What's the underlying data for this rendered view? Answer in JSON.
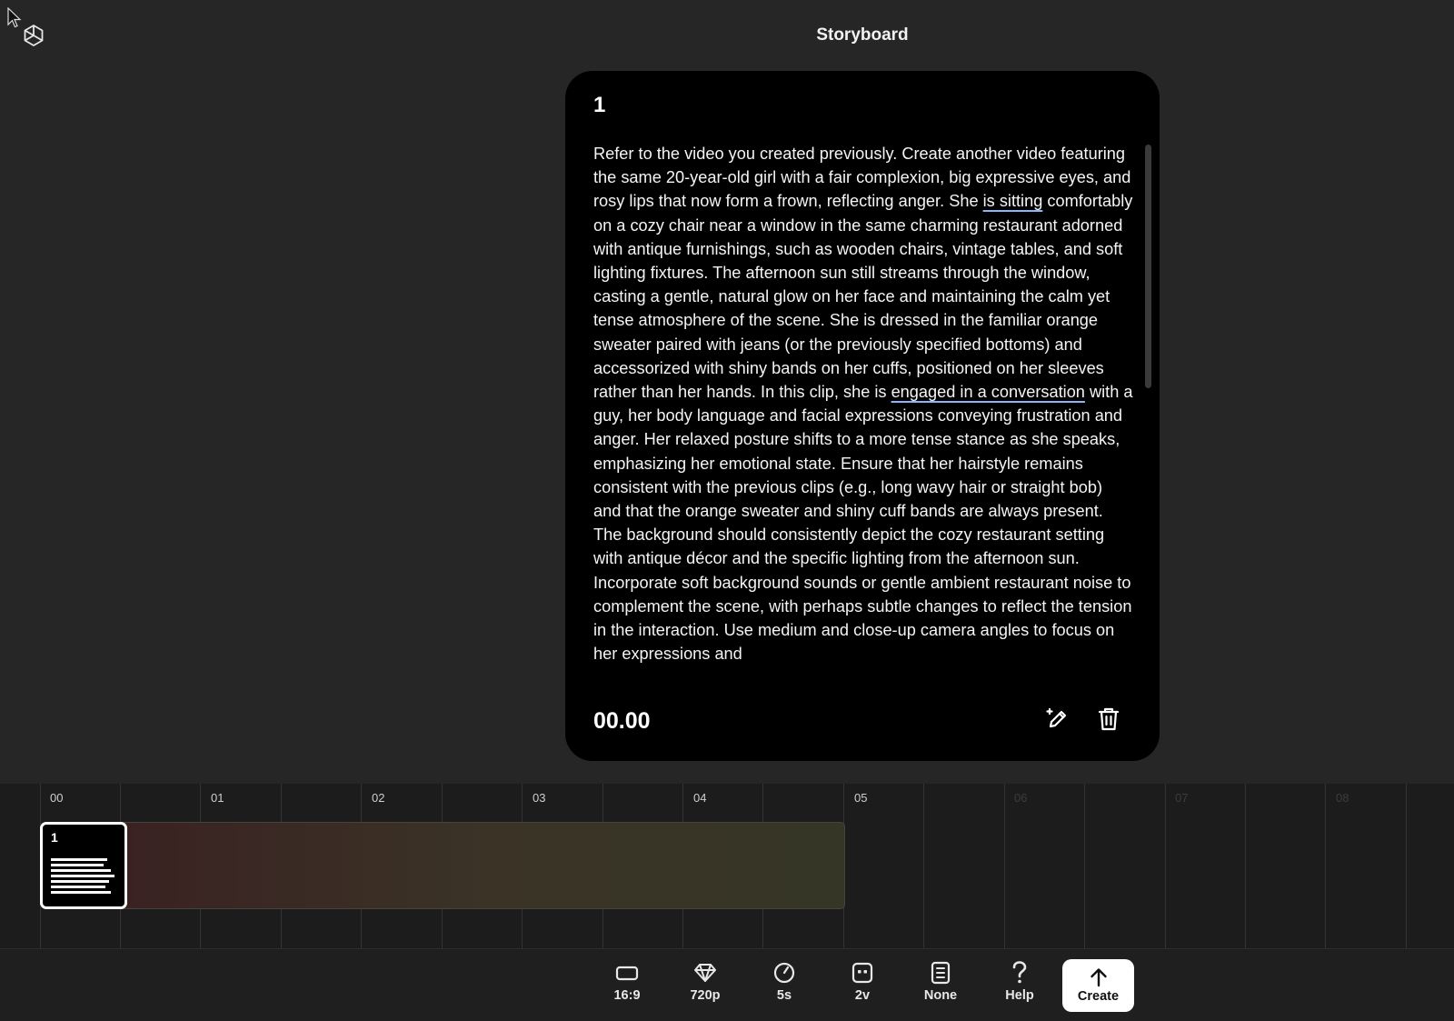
{
  "header": {
    "title": "Storyboard",
    "logo": "openai-logo"
  },
  "card": {
    "number": "1",
    "text_parts": {
      "p1": "Refer to the video you created previously. Create another video featuring the same 20-year-old girl with a fair complexion, big expressive eyes, and rosy lips that now form a frown, reflecting anger. She ",
      "u1": "is sitting",
      "p2": " comfortably on a cozy chair near a window in the same charming restaurant adorned with antique furnishings, such as wooden chairs, vintage tables, and soft lighting fixtures. The afternoon sun still streams through the window, casting a gentle, natural glow on her face and maintaining the calm yet tense atmosphere of the scene. She is dressed in the familiar orange sweater paired with jeans (or the previously specified bottoms) and accessorized with shiny bands on her cuffs, positioned on her sleeves rather than her hands. In this clip, she is ",
      "u2": "engaged in a conversation",
      "p3": " with a guy, her body language and facial expressions conveying frustration and anger. Her relaxed posture shifts to a more tense stance as she speaks, emphasizing her emotional state. Ensure that her hairstyle remains consistent with the previous clips (e.g., long wavy hair or straight bob) and that the orange sweater and shiny cuff bands are always present. The background should consistently depict the cozy restaurant setting with antique décor and the specific lighting from the afternoon sun. Incorporate soft background sounds or gentle ambient restaurant noise to complement the scene, with perhaps subtle changes to reflect the tension in the interaction. Use medium and close-up camera angles to focus on her expressions and"
    },
    "duration": "00.00",
    "actions": {
      "edit_icon": "magic-pencil-icon",
      "delete_icon": "trash-icon"
    }
  },
  "timeline": {
    "ticks": [
      "00",
      "01",
      "02",
      "03",
      "04",
      "05",
      "06",
      "07",
      "08"
    ],
    "clip": {
      "number": "1"
    }
  },
  "toolbar": {
    "items": [
      {
        "label": "16:9",
        "icon": "aspect-ratio-icon"
      },
      {
        "label": "720p",
        "icon": "diamond-icon"
      },
      {
        "label": "5s",
        "icon": "timer-icon"
      },
      {
        "label": "2v",
        "icon": "variations-icon"
      },
      {
        "label": "None",
        "icon": "preset-icon"
      },
      {
        "label": "Help",
        "icon": "help-icon"
      }
    ],
    "create_label": "Create"
  }
}
